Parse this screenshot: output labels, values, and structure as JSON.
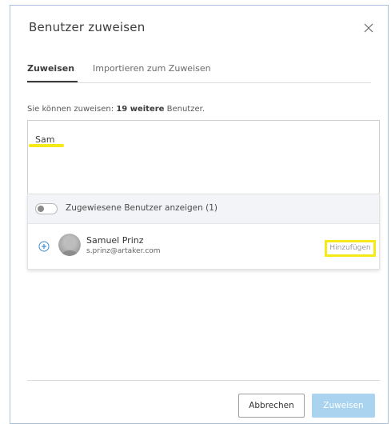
{
  "dialog": {
    "title": "Benutzer zuweisen"
  },
  "tabs": [
    {
      "label": "Zuweisen",
      "active": true
    },
    {
      "label": "Importieren zum Zuweisen",
      "active": false
    }
  ],
  "info": {
    "prefix": "Sie können zuweisen: ",
    "count": "19 weitere",
    "suffix": " Benutzer."
  },
  "search": {
    "value": "Sam"
  },
  "toggle": {
    "label": "Zugewiesene Benutzer anzeigen (1)",
    "on": false
  },
  "results": [
    {
      "name": "Samuel Prinz",
      "email": "s.prinz@artaker.com",
      "action_label": "Hinzufügen"
    }
  ],
  "footer": {
    "cancel_label": "Abbrechen",
    "assign_label": "Zuweisen"
  },
  "colors": {
    "primary_disabled": "#a9d3ee",
    "highlight": "#f5ea17",
    "plus_icon": "#3d8fd1"
  }
}
